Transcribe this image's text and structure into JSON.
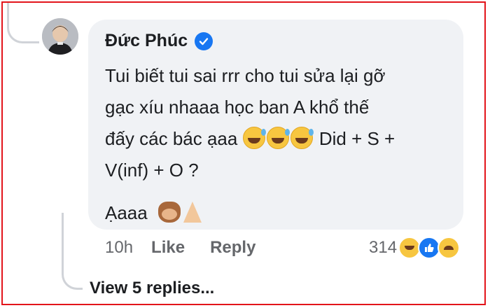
{
  "comment": {
    "author": "Đức Phúc",
    "lines": [
      "Tui biết tui sai rrr cho tui sửa lại gỡ",
      "gạc xíu nhaaa học ban A khổ thế",
      "đấy các bác ạaa",
      "Did + S +",
      "V(inf) + O ?",
      "Ạaaa"
    ],
    "time": "10h",
    "like_label": "Like",
    "reply_label": "Reply",
    "reaction_count": "314"
  },
  "replies": {
    "label": "View 5 replies..."
  },
  "icons": [
    "verified-badge-icon",
    "grinning-sweat-emoji",
    "see-no-evil-monkey-emoji",
    "folded-hands-emoji",
    "haha-reaction-icon",
    "like-reaction-icon",
    "sad-reaction-icon"
  ],
  "colors": {
    "border": "#e3141b",
    "bubble": "#f0f2f5",
    "verified": "#1877f2",
    "meta_text": "#65676b"
  }
}
